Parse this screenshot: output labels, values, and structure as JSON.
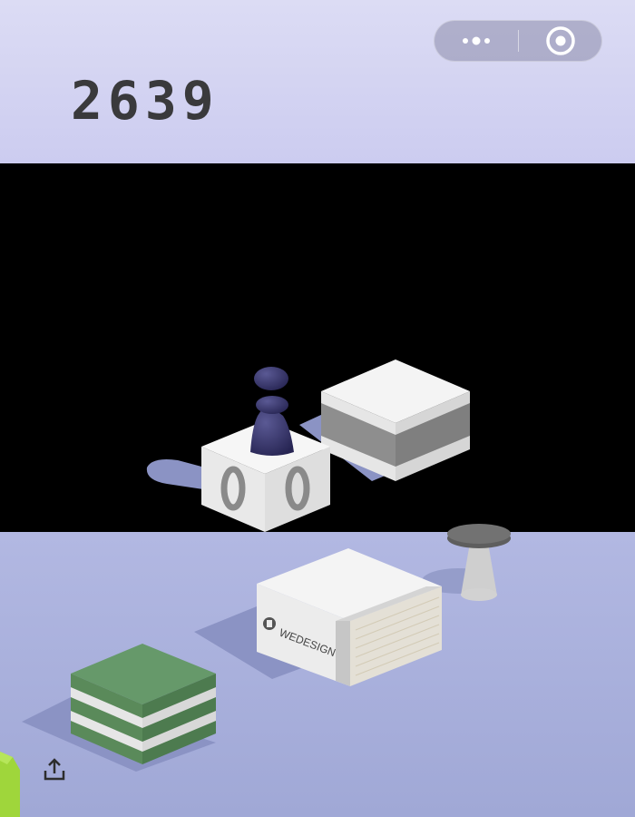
{
  "game": {
    "score": "2639",
    "block_label": "WEDESIGN"
  },
  "capsule": {
    "more_icon": "more-dots-icon",
    "close_icon": "target-circle-icon"
  },
  "toolbar": {
    "share_icon": "share-upload-icon"
  },
  "colors": {
    "sky": "#d6d6f2",
    "floor": "#a9b0d8",
    "score": "#3a3a3c",
    "piece": "#2f2d63",
    "green_block": "#5d8a59"
  }
}
